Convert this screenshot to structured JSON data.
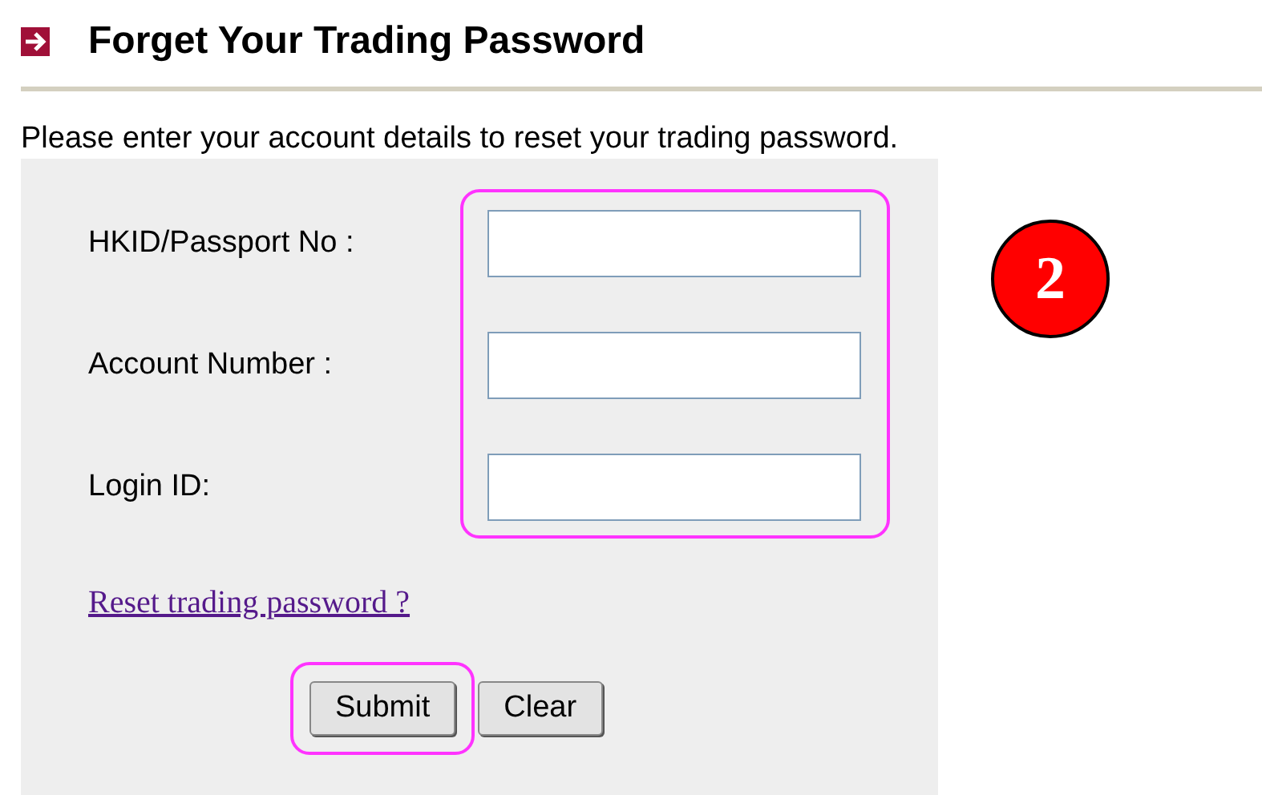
{
  "header": {
    "title": "Forget Your Trading Password"
  },
  "intro": "Please enter your account details to reset your trading password.",
  "form": {
    "fields": [
      {
        "label": "HKID/Passport No :"
      },
      {
        "label": "Account Number :"
      },
      {
        "label": "Login ID:"
      }
    ],
    "link": "Reset trading password ?",
    "buttons": [
      {
        "label": "Submit",
        "highlighted": true
      },
      {
        "label": "Clear",
        "highlighted": false
      }
    ]
  },
  "step_badge": "2"
}
